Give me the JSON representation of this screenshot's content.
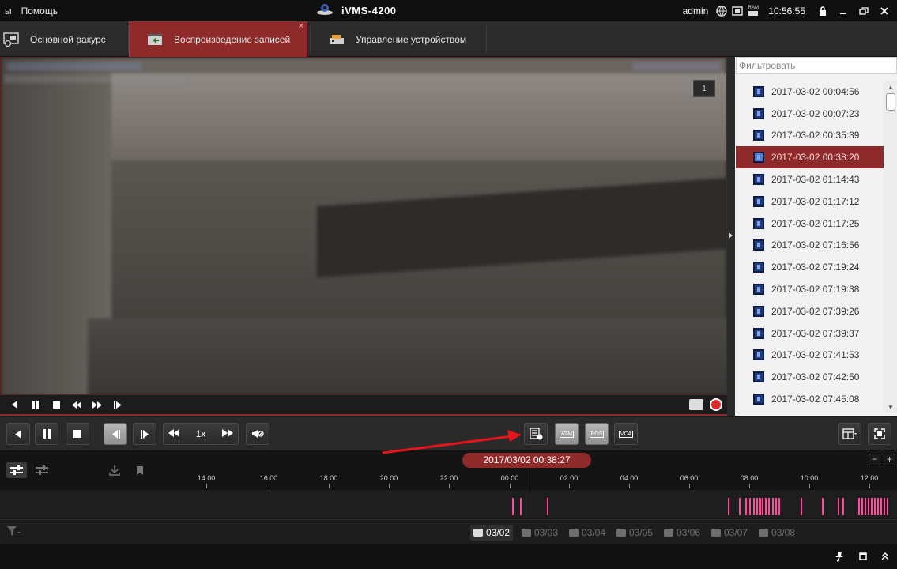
{
  "titlebar": {
    "menu": [
      "ы",
      "Помощь"
    ],
    "app_name": "iVMS-4200",
    "user": "admin",
    "ram_label": "RAM",
    "clock": "10:56:55"
  },
  "tabs": [
    {
      "label": "Основной ракурс",
      "active": false
    },
    {
      "label": "Воспроизведение записей",
      "active": true
    },
    {
      "label": "Управление устройством",
      "active": false
    }
  ],
  "video": {
    "badge": "1"
  },
  "right_panel": {
    "filter_placeholder": "Фильтровать",
    "files": [
      {
        "label": "2017-03-02 00:04:56",
        "selected": false
      },
      {
        "label": "2017-03-02 00:07:23",
        "selected": false
      },
      {
        "label": "2017-03-02 00:35:39",
        "selected": false
      },
      {
        "label": "2017-03-02 00:38:20",
        "selected": true
      },
      {
        "label": "2017-03-02 01:14:43",
        "selected": false
      },
      {
        "label": "2017-03-02 01:17:12",
        "selected": false
      },
      {
        "label": "2017-03-02 01:17:25",
        "selected": false
      },
      {
        "label": "2017-03-02 07:16:56",
        "selected": false
      },
      {
        "label": "2017-03-02 07:19:24",
        "selected": false
      },
      {
        "label": "2017-03-02 07:19:38",
        "selected": false
      },
      {
        "label": "2017-03-02 07:39:26",
        "selected": false
      },
      {
        "label": "2017-03-02 07:39:37",
        "selected": false
      },
      {
        "label": "2017-03-02 07:41:53",
        "selected": false
      },
      {
        "label": "2017-03-02 07:42:50",
        "selected": false
      },
      {
        "label": "2017-03-02 07:45:08",
        "selected": false
      }
    ]
  },
  "toolbar": {
    "speed": "1x",
    "atm_label": "ATM",
    "pos_label": "POS",
    "vca_label": "VCA"
  },
  "timeline": {
    "current_time": "2017/03/02 00:38:27",
    "ticks": [
      "14:00",
      "16:00",
      "18:00",
      "20:00",
      "22:00",
      "00:00",
      "02:00",
      "04:00",
      "06:00",
      "08:00",
      "10:00",
      "12:00"
    ],
    "zoom_out": "−",
    "zoom_in": "+"
  },
  "dates": [
    {
      "label": "03/02",
      "active": true
    },
    {
      "label": "03/03",
      "active": false
    },
    {
      "label": "03/04",
      "active": false
    },
    {
      "label": "03/05",
      "active": false
    },
    {
      "label": "03/06",
      "active": false
    },
    {
      "label": "03/07",
      "active": false
    },
    {
      "label": "03/08",
      "active": false
    }
  ],
  "colors": {
    "accent": "#8e2a2a",
    "record_mark": "#ff4b9a",
    "arrow": "#e8141c"
  }
}
